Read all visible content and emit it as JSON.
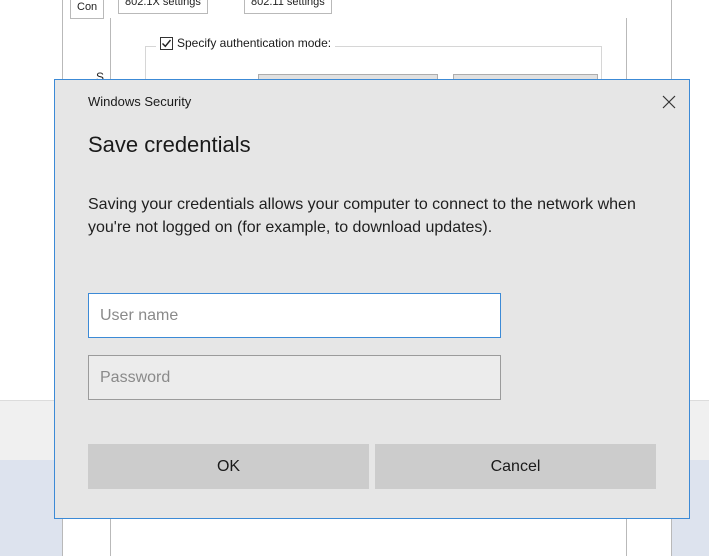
{
  "background_window": {
    "tabs": [
      {
        "label": "Con"
      },
      {
        "label": "802.1X settings"
      },
      {
        "label": "802.11 settings"
      }
    ],
    "specify_auth_checkbox": {
      "label": "Specify authentication mode:",
      "checked": true
    },
    "side_label": "S"
  },
  "dialog": {
    "caption": "Windows Security",
    "close_icon": "close-icon",
    "heading": "Save credentials",
    "message": "Saving your credentials allows your computer to connect to the network when you're not logged on (for example, to download updates).",
    "username": {
      "placeholder": "User name",
      "value": ""
    },
    "password": {
      "placeholder": "Password",
      "value": ""
    },
    "ok_label": "OK",
    "cancel_label": "Cancel"
  },
  "colors": {
    "dialog_bg": "#e6e6e6",
    "accent_border": "#3c8ad6",
    "button_bg": "#cccccc"
  }
}
